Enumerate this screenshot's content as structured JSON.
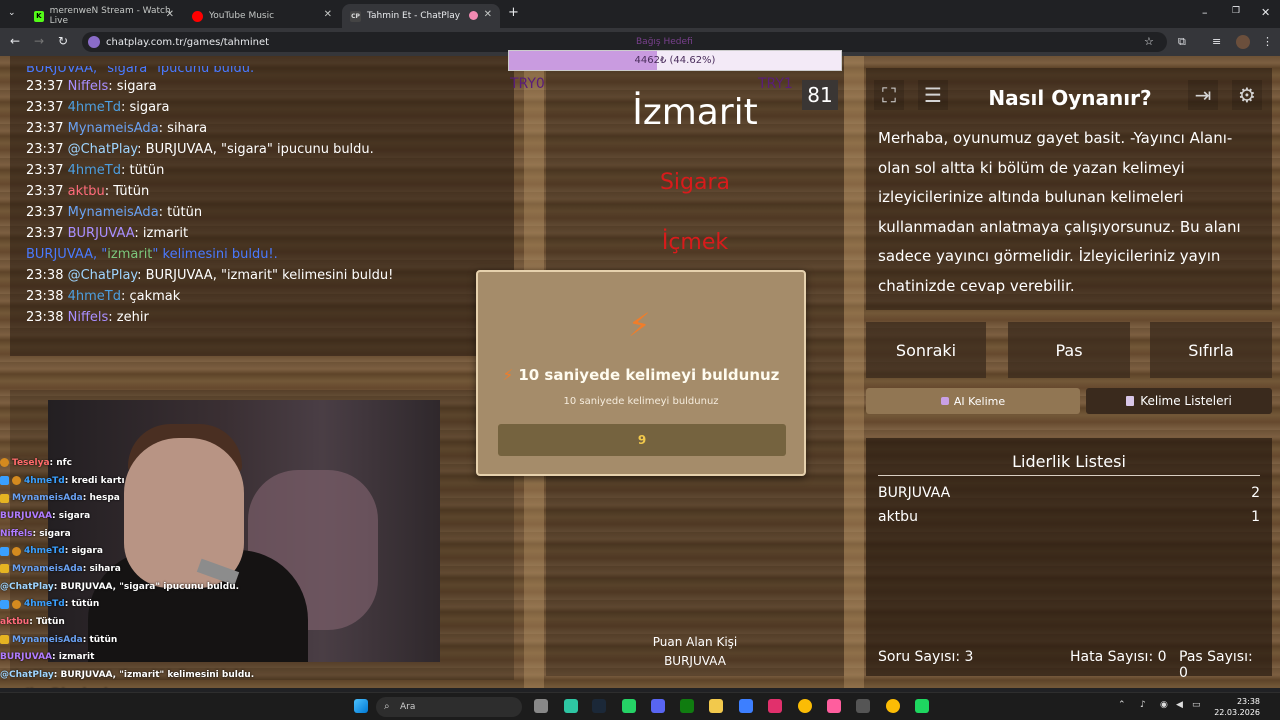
{
  "browser": {
    "tabs": [
      {
        "title": "merenweN Stream - Watch Live",
        "icon": "kick-icon",
        "color": "#53fc18"
      },
      {
        "title": "YouTube Music",
        "icon": "youtube-music-icon",
        "color": "#ff0000"
      },
      {
        "title": "Tahmin Et - ChatPlay",
        "icon": "chatplay-icon",
        "color": "#bbbbbb"
      }
    ],
    "url": "chatplay.com.tr/games/tahminet"
  },
  "game": {
    "progress": {
      "text": "4462₺ (44.62%)",
      "percent": 44.62,
      "ghost_label": "Bağış Hedefi"
    },
    "try_left": "TRY0",
    "try_right": "TRY1",
    "timer": "81",
    "word": "İzmarit",
    "taboo_words": [
      "Sigara",
      "İçmek"
    ],
    "scorer_label": "Puan Alan Kişi",
    "scorer_name": "BURJUVAA",
    "modal": {
      "title": "10 saniyede kelimeyi buldunuz",
      "subtitle": "10 saniyede kelimeyi buldunuz",
      "value": "9"
    },
    "howto": {
      "title": "Nasıl Oynanır?",
      "text": "Merhaba, oyunumuz gayet basit. -Yayıncı Alanı- olan sol altta ki bölüm de yazan kelimeyi izleyicilerinize altında bulunan kelimeleri kullanmadan anlatmaya çalışıyorsunuz. Bu alanı sadece yayıncı görmelidir. İzleyicileriniz yayın chatinizde cevap verebilir."
    },
    "buttons": {
      "next": "Sonraki",
      "pass": "Pas",
      "reset": "Sıfırla",
      "ai_word": "AI Kelime",
      "word_lists": "Kelime Listeleri"
    },
    "leaderboard": {
      "title": "Liderlik Listesi",
      "rows": [
        {
          "name": "BURJUVAA",
          "score": "2"
        },
        {
          "name": "aktbu",
          "score": "1"
        }
      ]
    },
    "stats": {
      "questions": "Soru Sayısı: 3",
      "errors": "Hata Sayısı: 0",
      "passes": "Pas Sayısı: 0"
    }
  },
  "chat": {
    "partial_top": "BURJUVAA, \"sigara\" ipucunu buldu.",
    "lines": [
      {
        "time": "23:37",
        "user": "Niffels",
        "msg": ": sigara",
        "cls": "nm-purple"
      },
      {
        "time": "23:37",
        "user": "4hmeTd",
        "msg": ": sigara",
        "cls": "nm-blue"
      },
      {
        "time": "23:37",
        "user": "MynameisAda",
        "msg": ": sihara",
        "cls": "nm-blue2"
      },
      {
        "time": "23:37",
        "user": "@ChatPlay",
        "msg": ": BURJUVAA, \"sigara\" ipucunu buldu.",
        "cls": "nm-teal"
      },
      {
        "time": "23:37",
        "user": "4hmeTd",
        "msg": ": tütün",
        "cls": "nm-blue"
      },
      {
        "time": "23:37",
        "user": "aktbu",
        "msg": ": Tütün",
        "cls": "nm-red"
      },
      {
        "time": "23:37",
        "user": "MynameisAda",
        "msg": ": tütün",
        "cls": "nm-blue2"
      },
      {
        "time": "23:37",
        "user": "BURJUVAA",
        "msg": ": izmarit",
        "cls": "nm-purple"
      }
    ],
    "system": {
      "pre": "BURJUVAA, \"",
      "word": "izmarit",
      "post": "\" kelimesini buldu!."
    },
    "lines2": [
      {
        "time": "23:38",
        "user": "@ChatPlay",
        "msg": ": BURJUVAA, \"izmarit\" kelimesini buldu!",
        "cls": "nm-teal"
      },
      {
        "time": "23:38",
        "user": "4hmeTd",
        "msg": ": çakmak",
        "cls": "nm-blue"
      },
      {
        "time": "23:38",
        "user": "Niffels",
        "msg": ": zehir",
        "cls": "nm-purple"
      }
    ]
  },
  "overlay_chat": [
    {
      "user": "Teselya",
      "msg": " : nfc",
      "color": "#ff6b6b",
      "badges": [
        "o"
      ]
    },
    {
      "user": "4hmeTd",
      "msg": " : kredi kartı",
      "color": "#3aa0ff",
      "badges": [
        "b",
        "o"
      ]
    },
    {
      "user": "MynameisAda",
      "msg": " : hespa",
      "color": "#6aa1f2",
      "badges": [
        "y"
      ]
    },
    {
      "user": "BURJUVAA",
      "msg": " : sigara",
      "color": "#b07cff",
      "badges": []
    },
    {
      "user": "Niffels",
      "msg": " : sigara",
      "color": "#b07cff",
      "badges": []
    },
    {
      "user": "4hmeTd",
      "msg": " : sigara",
      "color": "#3aa0ff",
      "badges": [
        "b",
        "o"
      ]
    },
    {
      "user": "MynameisAda",
      "msg": " : sihara",
      "color": "#6aa1f2",
      "badges": [
        "y"
      ]
    },
    {
      "user": "@ChatPlay",
      "msg": " : BURJUVAA, \"sigara\" ipucunu buldu.",
      "color": "#9fd5ff",
      "badges": []
    },
    {
      "user": "4hmeTd",
      "msg": " : tütün",
      "color": "#3aa0ff",
      "badges": [
        "b",
        "o"
      ]
    },
    {
      "user": "aktbu",
      "msg": " : Tütün",
      "color": "#ff6b7b",
      "badges": []
    },
    {
      "user": "MynameisAda",
      "msg": " : tütün",
      "color": "#6aa1f2",
      "badges": [
        "y"
      ]
    },
    {
      "user": "BURJUVAA",
      "msg": " : izmarit",
      "color": "#b07cff",
      "badges": []
    },
    {
      "user": "@ChatPlay",
      "msg": " : BURJUVAA, \"izmarit\" kelimesini buldu.",
      "color": "#9fd5ff",
      "badges": []
    },
    {
      "user": "4hmeTd",
      "msg": " : çakmak",
      "color": "#3aa0ff",
      "badges": [
        "b",
        "o"
      ]
    },
    {
      "user": "Niffels",
      "msg": " : zehir",
      "color": "#b07cff",
      "badges": []
    }
  ],
  "taskbar": {
    "search": "Ara",
    "time": "23:38",
    "date": "22.03.2026"
  }
}
